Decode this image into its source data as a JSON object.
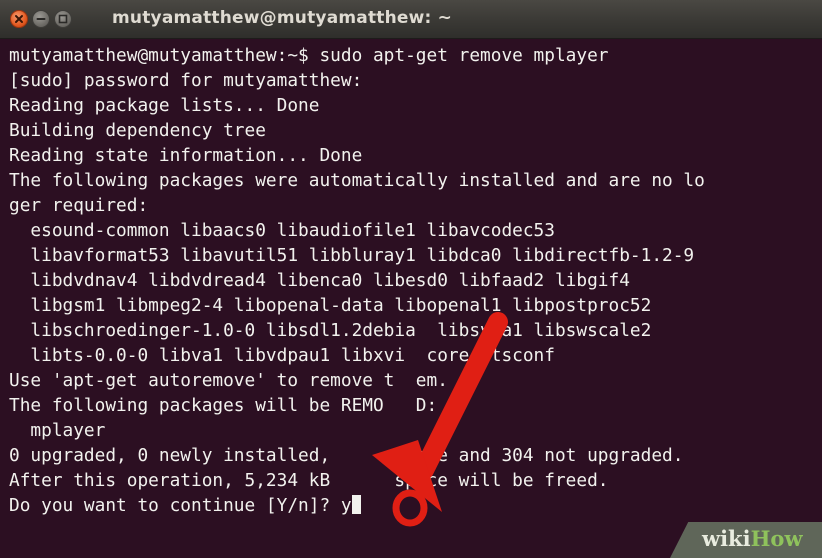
{
  "window": {
    "title": "mutyamatthew@mutyamatthew: ~",
    "controls": {
      "close_icon": "close-icon",
      "minimize_icon": "minimize-icon",
      "maximize_icon": "maximize-icon"
    }
  },
  "terminal": {
    "lines": [
      "mutyamatthew@mutyamatthew:~$ sudo apt-get remove mplayer",
      "[sudo] password for mutyamatthew:",
      "Reading package lists... Done",
      "Building dependency tree",
      "Reading state information... Done",
      "The following packages were automatically installed and are no lo",
      "ger required:",
      "  esound-common libaacs0 libaudiofile1 libavcodec53",
      "  libavformat53 libavutil51 libbluray1 libdca0 libdirectfb-1.2-9",
      "  libdvdnav4 libdvdread4 libenca0 libesd0 libfaad2 libgif4",
      "  libgsm1 libmpeg2-4 libopenal-data libopenal1 libpostproc52",
      "  libschroedinger-1.0-0 libsdl1.2debia  libsvga1 libswscale2",
      "  libts-0.0-0 libva1 libvdpau1 libxvi  core4 tsconf",
      "Use 'apt-get autoremove' to remove t  em.",
      "The following packages will be REMO   D:",
      "  mplayer",
      "0 upgraded, 0 newly installed,      emove and 304 not upgraded.",
      "After this operation, 5,234 kB      space will be freed."
    ],
    "prompt": "Do you want to continue [Y/n]? ",
    "typed_input": "y"
  },
  "annotation": {
    "arrow_color": "#e01f14",
    "circle_color": "#e01f14",
    "target": "typed-input"
  },
  "watermark": {
    "part1": "wiki",
    "part2": "How"
  },
  "colors": {
    "terminal_background": "#2c0f22",
    "terminal_text": "#f2f2ee",
    "titlebar": "#3a3935"
  }
}
